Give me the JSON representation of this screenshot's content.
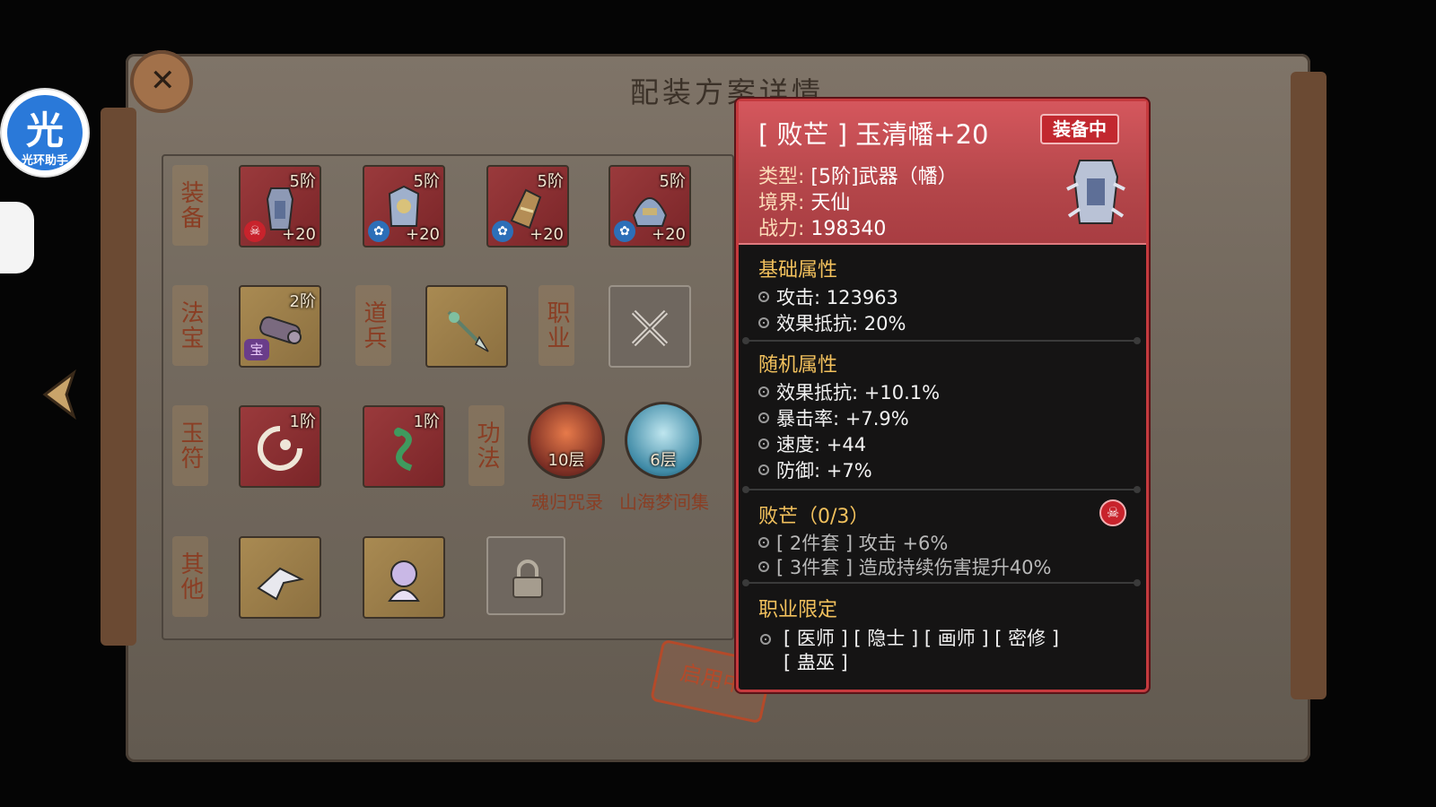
{
  "page_title": "配装方案详情",
  "loadout": {
    "rows": {
      "equipment": "装备",
      "treasure": "法宝",
      "soldier": "道兵",
      "profession": "职业",
      "talisman": "玉符",
      "technique": "功法",
      "other": "其他"
    },
    "equipment_slots": [
      {
        "tier": "5阶",
        "plus": "+20",
        "badge": "skull"
      },
      {
        "tier": "5阶",
        "plus": "+20",
        "badge": "flower"
      },
      {
        "tier": "5阶",
        "plus": "+20",
        "badge": "flower"
      },
      {
        "tier": "5阶",
        "plus": "+20",
        "badge": "flower"
      }
    ],
    "treasure_slot": {
      "tier": "2阶",
      "mark": "宝"
    },
    "talisman_slots": [
      {
        "tier": "1阶"
      },
      {
        "tier": "1阶"
      }
    ],
    "techniques": [
      {
        "name": "魂归咒录",
        "layer": "10层"
      },
      {
        "name": "山海梦间集",
        "layer": "6层"
      }
    ],
    "enabled_stamp": "启用中"
  },
  "assistant": {
    "glyph": "光",
    "name": "光环助手"
  },
  "tooltip": {
    "title": "[ 败芒 ] 玉清幡+20",
    "equipped_badge": "装备中",
    "type_key": "类型:",
    "type_val": "[5阶]武器（幡）",
    "realm_key": "境界:",
    "realm_val": "天仙",
    "power_key": "战力:",
    "power_val": "198340",
    "base_title": "基础属性",
    "base_stats": [
      "攻击: 123963",
      "效果抵抗: 20%"
    ],
    "random_title": "随机属性",
    "random_stats": [
      "效果抵抗: +10.1%",
      "暴击率: +7.9%",
      "速度: +44",
      "防御: +7%"
    ],
    "set_title": "败芒（0/3）",
    "set_bonuses": [
      "[ 2件套 ] 攻击 +6%",
      "[ 3件套 ] 造成持续伤害提升40%"
    ],
    "class_title": "职业限定",
    "class_line1": "[ 医师 ] [ 隐士 ] [ 画师 ] [ 密修 ]",
    "class_line2": "[ 蛊巫 ]"
  },
  "colors": {
    "tooltip_border": "#c53a3e",
    "tooltip_header": "#b4464a",
    "section_title": "#f2c15d",
    "row_label": "#8a3e24"
  },
  "icons": [
    "skull-icon",
    "flower-badge-icon",
    "back-arrow-icon",
    "lock-icon",
    "banner-weapon-icon"
  ]
}
